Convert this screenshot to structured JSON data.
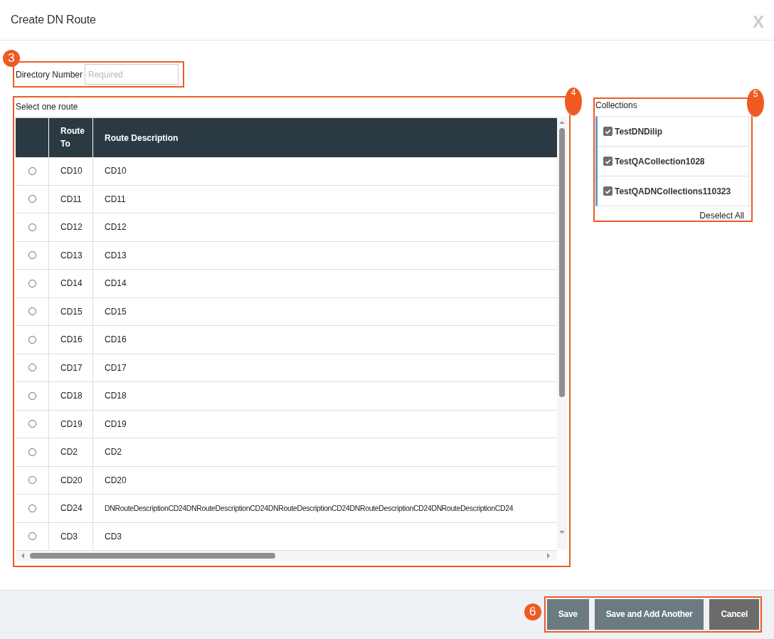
{
  "dialog": {
    "title": "Create DN Route",
    "close_label": "X"
  },
  "directory_number": {
    "callout": "3",
    "label": "Directory Number",
    "placeholder": "Required"
  },
  "routes": {
    "callout": "4",
    "caption": "Select one route",
    "columns": [
      "Route To",
      "Route Description"
    ],
    "rows": [
      {
        "route_to": "CD10",
        "description": "CD10",
        "selected": false
      },
      {
        "route_to": "CD11",
        "description": "CD11",
        "selected": false
      },
      {
        "route_to": "CD12",
        "description": "CD12",
        "selected": false
      },
      {
        "route_to": "CD13",
        "description": "CD13",
        "selected": false
      },
      {
        "route_to": "CD14",
        "description": "CD14",
        "selected": false
      },
      {
        "route_to": "CD15",
        "description": "CD15",
        "selected": false
      },
      {
        "route_to": "CD16",
        "description": "CD16",
        "selected": false
      },
      {
        "route_to": "CD17",
        "description": "CD17",
        "selected": false
      },
      {
        "route_to": "CD18",
        "description": "CD18",
        "selected": false
      },
      {
        "route_to": "CD19",
        "description": "CD19",
        "selected": false
      },
      {
        "route_to": "CD2",
        "description": "CD2",
        "selected": false
      },
      {
        "route_to": "CD20",
        "description": "CD20",
        "selected": false
      },
      {
        "route_to": "CD24",
        "description": "DNRouteDescriptionCD24DNRouteDescriptionCD24DNRouteDescriptionCD24DNRouteDescriptionCD24DNRouteDescriptionCD24",
        "selected": false
      },
      {
        "route_to": "CD3",
        "description": "CD3",
        "selected": false
      }
    ]
  },
  "collections": {
    "callout": "5",
    "caption": "Collections",
    "items": [
      {
        "name": "TestDNDilip",
        "checked": true
      },
      {
        "name": "TestQACollection1028",
        "checked": true
      },
      {
        "name": "TestQADNCollections110323",
        "checked": true
      }
    ],
    "deselect_all": "Deselect All"
  },
  "footer": {
    "callout": "6",
    "buttons": [
      {
        "label": "Save",
        "kind": "action"
      },
      {
        "label": "Save and Add Another",
        "kind": "action"
      },
      {
        "label": "Cancel",
        "kind": "cancel"
      }
    ]
  }
}
